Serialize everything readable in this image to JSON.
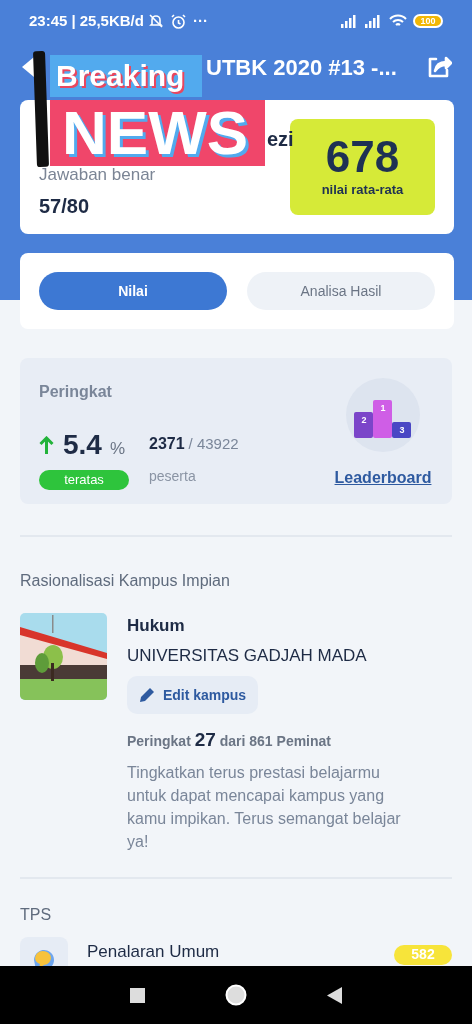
{
  "status_bar": {
    "time": "23:45",
    "speed": "| 25,5KB/d",
    "more": "···",
    "battery": "100"
  },
  "header": {
    "title": "UTBK 2020 #13 -..."
  },
  "overlay": {
    "line_1": "Breaking",
    "line_2": "NEWS"
  },
  "score_card": {
    "name_fragment": "ezi",
    "correct_label": "Jawaban benar",
    "correct_value": "57/80",
    "score": "678",
    "score_label": "nilai rata-rata"
  },
  "tabs": [
    {
      "label": "Nilai",
      "selected": true
    },
    {
      "label": "Analisa Hasil",
      "selected": false
    }
  ],
  "ranking": {
    "title": "Peringkat",
    "percent": "5.4",
    "percent_unit": "%",
    "badge": "teratas",
    "rank": "2371",
    "total": "/ 43922",
    "rank_label": "peserta",
    "podium": [
      "2",
      "1",
      "3"
    ],
    "link": "Leaderboard"
  },
  "dream_campus": {
    "title": "Rasionalisasi Kampus Impian",
    "major": "Hukum",
    "university": "UNIVERSITAS GADJAH MADA",
    "edit_button": "Edit kampus",
    "rank_text": "Peringkat **27** dari 861 Peminat",
    "message": "Tingkatkan terus prestasi belajarmu untuk dapat mencapai kampus yang kamu impikan. Terus semangat belajar ya!"
  },
  "tps": {
    "title": "TPS",
    "items": [
      {
        "name": "Penalaran Umum",
        "score": "582"
      }
    ]
  }
}
